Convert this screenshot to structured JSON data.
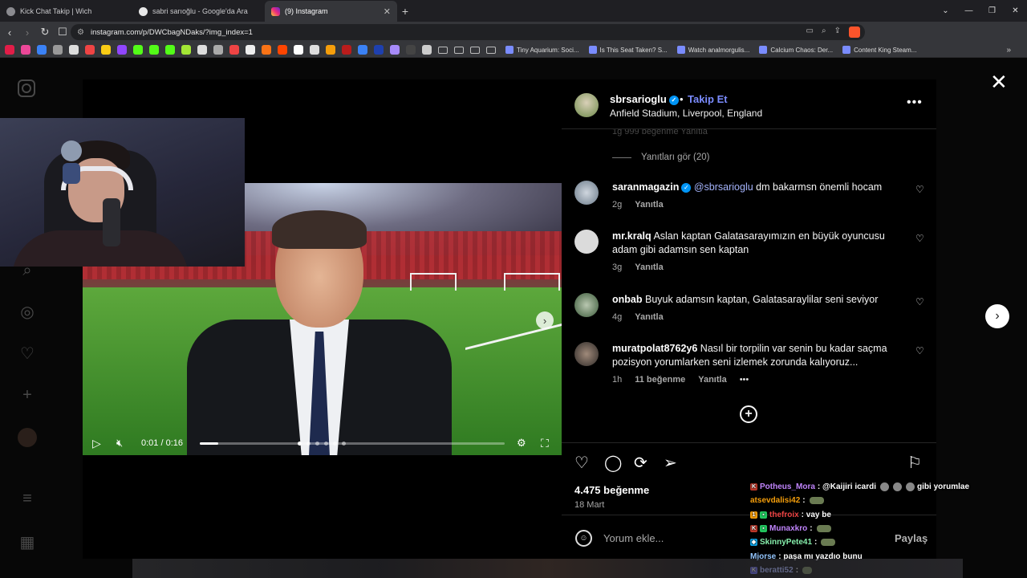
{
  "browser": {
    "tabs": [
      {
        "title": "Kick Chat Takip | Wich",
        "active": false
      },
      {
        "title": "sabri sarıoğlu - Google'da Ara",
        "active": false
      },
      {
        "title": "(9) Instagram",
        "active": true
      }
    ],
    "url": "instagram.com/p/DWCbagNDaks/?img_index=1",
    "bookmarks": [
      "Tiny Aquarium: Soci...",
      "Is This Seat Taken? S...",
      "Watch analmorgulis...",
      "Calcium Chaos: Der...",
      "Content King Steam..."
    ]
  },
  "video": {
    "time": "0:01 / 0:16",
    "progress": 0.06,
    "slide_count": 6,
    "active_slide": 0
  },
  "post": {
    "username": "sbrsarioglu",
    "follow_label": "Takip Et",
    "location": "Anfield Stadium, Liverpool, England",
    "ghost_meta": "1g   999 beğenme   Yanıtla",
    "view_replies": "Yanıtları gör (20)",
    "comments": [
      {
        "user": "saranmagazin",
        "verified": true,
        "mention": "@sbrsarioglu",
        "text": "dm bakarmsn önemli hocam",
        "age": "2g",
        "likes": "",
        "reply": "Yanıtla"
      },
      {
        "user": "mr.kralq",
        "verified": false,
        "mention": "",
        "text": "Aslan kaptan Galatasarayımızın en büyük oyuncusu adam gibi adamsın sen kaptan",
        "age": "3g",
        "likes": "",
        "reply": "Yanıtla"
      },
      {
        "user": "onbab",
        "verified": false,
        "mention": "",
        "text": "Buyuk adamsın kaptan, Galatasaraylilar seni seviyor",
        "age": "4g",
        "likes": "",
        "reply": "Yanıtla"
      },
      {
        "user": "muratpolat8762y6",
        "verified": false,
        "mention": "",
        "text": "Nasıl bir torpilin var senin bu kadar saçma pozisyon yorumlarken seni izlemek zorunda kalıyoruz...",
        "age": "1h",
        "likes": "11 beğenme",
        "reply": "Yanıtla"
      }
    ],
    "likes": "4.475 beğenme",
    "date": "18 Mart",
    "comment_placeholder": "Yorum ekle...",
    "share_label": "Paylaş"
  },
  "chat": [
    {
      "user": "Potheus_Mora",
      "color": "#c084fc",
      "text": ": @Kaijiri icardi",
      "tail": "gibi yorumlae"
    },
    {
      "user": "atsevdalisi42",
      "color": "#f59e0b",
      "text": ":",
      "tail": ""
    },
    {
      "user": "thefroix",
      "color": "#ef4444",
      "text": ": vay be",
      "tail": ""
    },
    {
      "user": "Munaxkro",
      "color": "#c084fc",
      "text": ":",
      "tail": ""
    },
    {
      "user": "SkinnyPete41",
      "color": "#86efac",
      "text": ":",
      "tail": ""
    },
    {
      "user": "Mjorse",
      "color": "#93c5fd",
      "text": ": paşa mı yazdıo bunu",
      "tail": ""
    },
    {
      "user": "beratti52",
      "color": "#a5b4fc",
      "text": ":",
      "tail": ""
    }
  ]
}
